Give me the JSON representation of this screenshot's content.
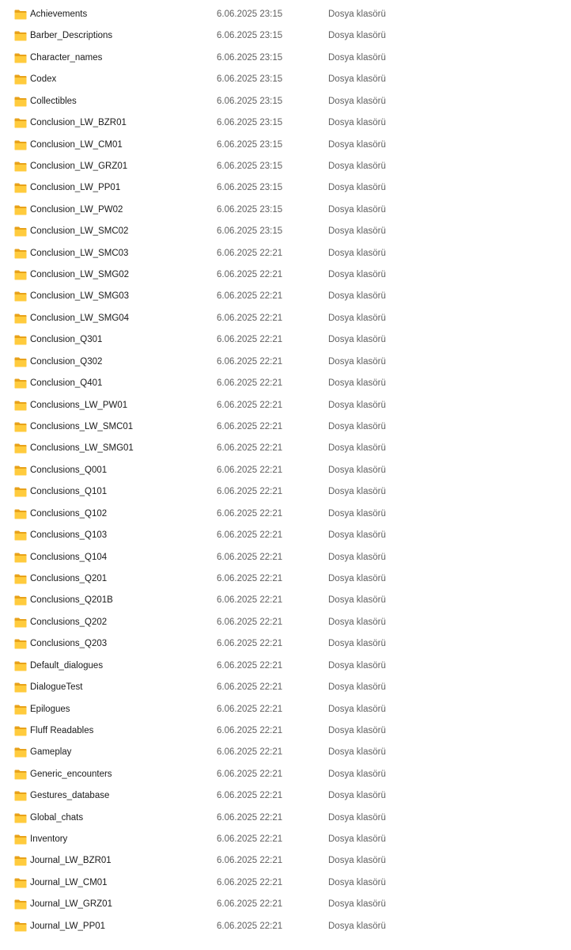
{
  "icons": {
    "folder": "folder-icon"
  },
  "colors": {
    "folder_back": "#E8A21A",
    "folder_front": "#FFCB3D",
    "meta_text": "#606060"
  },
  "files": [
    {
      "name": "Achievements",
      "modified": "6.06.2025 23:15",
      "type": "Dosya klasörü"
    },
    {
      "name": "Barber_Descriptions",
      "modified": "6.06.2025 23:15",
      "type": "Dosya klasörü"
    },
    {
      "name": "Character_names",
      "modified": "6.06.2025 23:15",
      "type": "Dosya klasörü"
    },
    {
      "name": "Codex",
      "modified": "6.06.2025 23:15",
      "type": "Dosya klasörü"
    },
    {
      "name": "Collectibles",
      "modified": "6.06.2025 23:15",
      "type": "Dosya klasörü"
    },
    {
      "name": "Conclusion_LW_BZR01",
      "modified": "6.06.2025 23:15",
      "type": "Dosya klasörü"
    },
    {
      "name": "Conclusion_LW_CM01",
      "modified": "6.06.2025 23:15",
      "type": "Dosya klasörü"
    },
    {
      "name": "Conclusion_LW_GRZ01",
      "modified": "6.06.2025 23:15",
      "type": "Dosya klasörü"
    },
    {
      "name": "Conclusion_LW_PP01",
      "modified": "6.06.2025 23:15",
      "type": "Dosya klasörü"
    },
    {
      "name": "Conclusion_LW_PW02",
      "modified": "6.06.2025 23:15",
      "type": "Dosya klasörü"
    },
    {
      "name": "Conclusion_LW_SMC02",
      "modified": "6.06.2025 23:15",
      "type": "Dosya klasörü"
    },
    {
      "name": "Conclusion_LW_SMC03",
      "modified": "6.06.2025 22:21",
      "type": "Dosya klasörü"
    },
    {
      "name": "Conclusion_LW_SMG02",
      "modified": "6.06.2025 22:21",
      "type": "Dosya klasörü"
    },
    {
      "name": "Conclusion_LW_SMG03",
      "modified": "6.06.2025 22:21",
      "type": "Dosya klasörü"
    },
    {
      "name": "Conclusion_LW_SMG04",
      "modified": "6.06.2025 22:21",
      "type": "Dosya klasörü"
    },
    {
      "name": "Conclusion_Q301",
      "modified": "6.06.2025 22:21",
      "type": "Dosya klasörü"
    },
    {
      "name": "Conclusion_Q302",
      "modified": "6.06.2025 22:21",
      "type": "Dosya klasörü"
    },
    {
      "name": "Conclusion_Q401",
      "modified": "6.06.2025 22:21",
      "type": "Dosya klasörü"
    },
    {
      "name": "Conclusions_LW_PW01",
      "modified": "6.06.2025 22:21",
      "type": "Dosya klasörü"
    },
    {
      "name": "Conclusions_LW_SMC01",
      "modified": "6.06.2025 22:21",
      "type": "Dosya klasörü"
    },
    {
      "name": "Conclusions_LW_SMG01",
      "modified": "6.06.2025 22:21",
      "type": "Dosya klasörü"
    },
    {
      "name": "Conclusions_Q001",
      "modified": "6.06.2025 22:21",
      "type": "Dosya klasörü"
    },
    {
      "name": "Conclusions_Q101",
      "modified": "6.06.2025 22:21",
      "type": "Dosya klasörü"
    },
    {
      "name": "Conclusions_Q102",
      "modified": "6.06.2025 22:21",
      "type": "Dosya klasörü"
    },
    {
      "name": "Conclusions_Q103",
      "modified": "6.06.2025 22:21",
      "type": "Dosya klasörü"
    },
    {
      "name": "Conclusions_Q104",
      "modified": "6.06.2025 22:21",
      "type": "Dosya klasörü"
    },
    {
      "name": "Conclusions_Q201",
      "modified": "6.06.2025 22:21",
      "type": "Dosya klasörü"
    },
    {
      "name": "Conclusions_Q201B",
      "modified": "6.06.2025 22:21",
      "type": "Dosya klasörü"
    },
    {
      "name": "Conclusions_Q202",
      "modified": "6.06.2025 22:21",
      "type": "Dosya klasörü"
    },
    {
      "name": "Conclusions_Q203",
      "modified": "6.06.2025 22:21",
      "type": "Dosya klasörü"
    },
    {
      "name": "Default_dialogues",
      "modified": "6.06.2025 22:21",
      "type": "Dosya klasörü"
    },
    {
      "name": "DialogueTest",
      "modified": "6.06.2025 22:21",
      "type": "Dosya klasörü"
    },
    {
      "name": "Epilogues",
      "modified": "6.06.2025 22:21",
      "type": "Dosya klasörü"
    },
    {
      "name": "Fluff Readables",
      "modified": "6.06.2025 22:21",
      "type": "Dosya klasörü"
    },
    {
      "name": "Gameplay",
      "modified": "6.06.2025 22:21",
      "type": "Dosya klasörü"
    },
    {
      "name": "Generic_encounters",
      "modified": "6.06.2025 22:21",
      "type": "Dosya klasörü"
    },
    {
      "name": "Gestures_database",
      "modified": "6.06.2025 22:21",
      "type": "Dosya klasörü"
    },
    {
      "name": "Global_chats",
      "modified": "6.06.2025 22:21",
      "type": "Dosya klasörü"
    },
    {
      "name": "Inventory",
      "modified": "6.06.2025 22:21",
      "type": "Dosya klasörü"
    },
    {
      "name": "Journal_LW_BZR01",
      "modified": "6.06.2025 22:21",
      "type": "Dosya klasörü"
    },
    {
      "name": "Journal_LW_CM01",
      "modified": "6.06.2025 22:21",
      "type": "Dosya klasörü"
    },
    {
      "name": "Journal_LW_GRZ01",
      "modified": "6.06.2025 22:21",
      "type": "Dosya klasörü"
    },
    {
      "name": "Journal_LW_PP01",
      "modified": "6.06.2025 22:21",
      "type": "Dosya klasörü"
    }
  ]
}
